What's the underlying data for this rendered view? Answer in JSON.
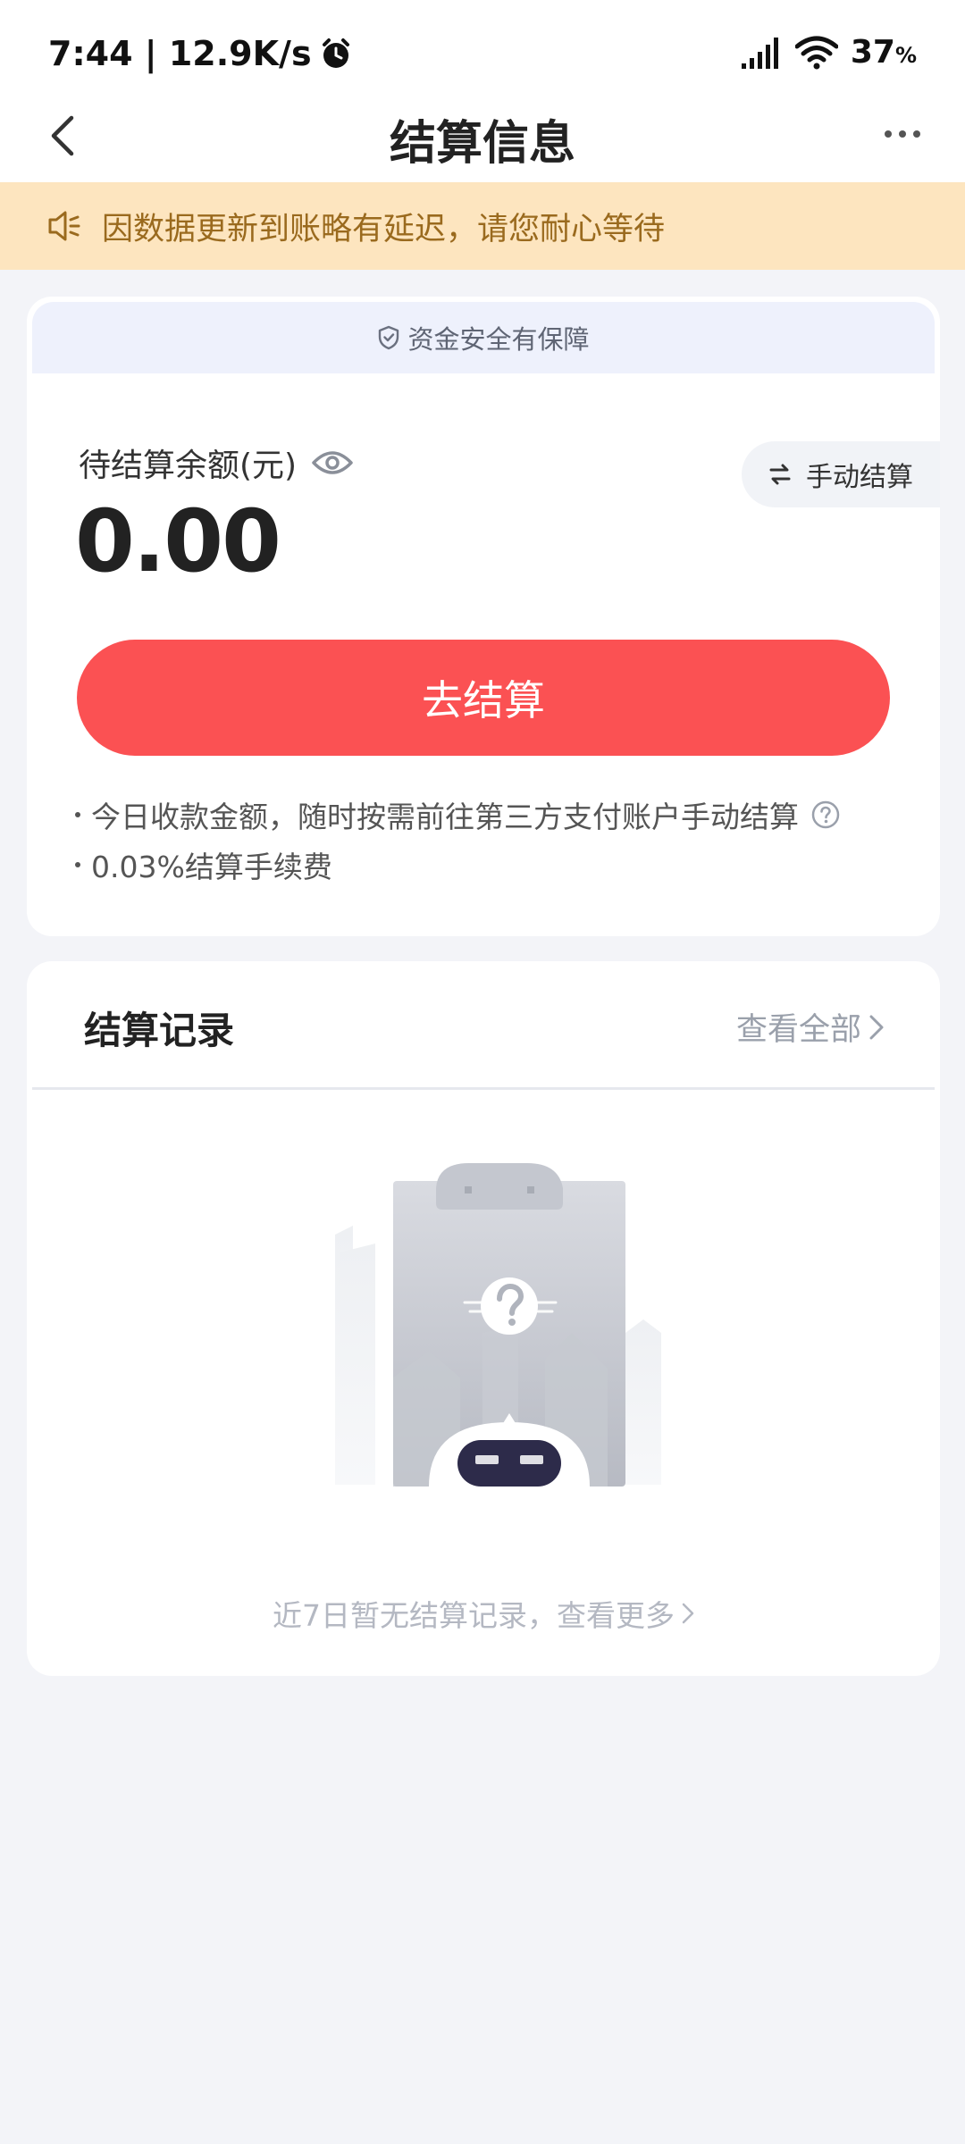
{
  "status_bar": {
    "time_speed": "7:44 | 12.9K/s",
    "battery": "37",
    "battery_unit": "%"
  },
  "nav": {
    "title": "结算信息"
  },
  "notice": {
    "text": "因数据更新到账略有延迟，请您耐心等待"
  },
  "balance": {
    "security_text": "资金安全有保障",
    "label": "待结算余额(元)",
    "value": "0.00",
    "manual_settle_label": "手动结算",
    "settle_button_label": "去结算",
    "notes": [
      "今日收款金额，随时按需前往第三方支付账户手动结算",
      "0.03%结算手续费"
    ]
  },
  "records": {
    "title": "结算记录",
    "view_all_label": "查看全部",
    "empty_text": "近7日暂无结算记录，查看更多"
  },
  "colors": {
    "primary_red": "#fb5153",
    "notice_bg": "#fde5bf",
    "notice_text": "#9a6a1e",
    "page_bg": "#f3f4f8"
  }
}
